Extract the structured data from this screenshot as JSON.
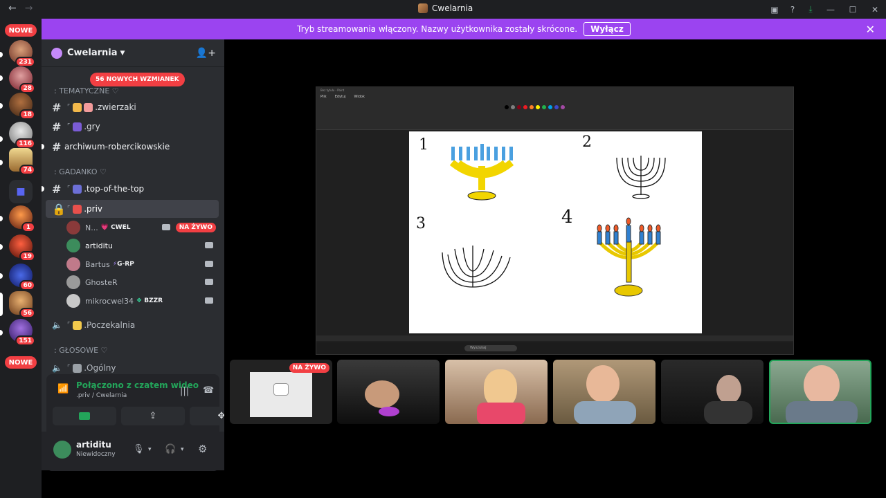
{
  "window": {
    "title": "Cwelarnia"
  },
  "banner": {
    "text": "Tryb streamowania włączony. Nazwy użytkownika zostały skrócone.",
    "button": "Wyłącz"
  },
  "rail": {
    "new_label_top": "NOWE",
    "new_label_bottom": "NOWE",
    "badges": [
      "231",
      "28",
      "18",
      "116",
      "74",
      "1",
      "19",
      "60",
      "56",
      "151"
    ]
  },
  "server": {
    "name": "Cwelarnia",
    "mentions_pill": "56 NOWYCH WZMIANEK"
  },
  "categories": {
    "tematyczne": ": TEMATYCZNE ♡",
    "gadanko": ": GADANKO ♡",
    "glosowe": ": GŁOSOWE ♡"
  },
  "channels": {
    "zwierzaki": ".zwierzaki",
    "gry": ".gry",
    "archiwum": "archiwum-robercikowskie",
    "top": ".top-of-the-top",
    "priv": ".priv",
    "poczekalnia": ".Poczekalnia",
    "ogolny": ".Ogólny"
  },
  "voice_users": [
    {
      "name": "N...",
      "tag": "CWEL",
      "live": "NA ŻYWO"
    },
    {
      "name": "artiditu",
      "tag": ""
    },
    {
      "name": "Bartus",
      "tag": "G-RP"
    },
    {
      "name": "GhosteR",
      "tag": ""
    },
    {
      "name": "mikrocwel34",
      "tag": "BZZR"
    }
  ],
  "voice_panel": {
    "title": "Połączono z czatem wideo",
    "subtitle": ".priv / Cwelarnia"
  },
  "user": {
    "name": "artiditu",
    "status": "Niewidoczny"
  },
  "stage": {
    "tile_live": "NA ŻYWO",
    "paint": {
      "title": "Bez tytułu - Paint",
      "menu": [
        "Plik",
        "Edytuj",
        "Widok"
      ],
      "search": "Wyszukaj"
    },
    "numbers": [
      "1",
      "2",
      "3",
      "4"
    ]
  }
}
